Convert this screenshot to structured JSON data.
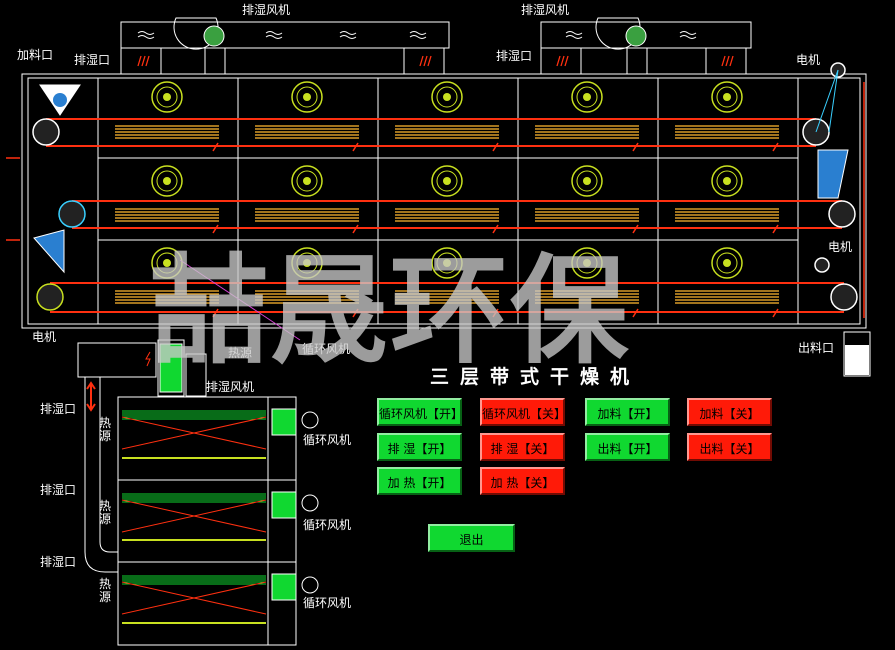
{
  "labels": {
    "dehumid_fan_1": "排湿风机",
    "dehumid_fan_2": "排湿风机",
    "feed_port": "加料口",
    "dehumid_port_1": "排湿口",
    "dehumid_port_2": "排湿口",
    "motor_top": "电机",
    "motor_mid": "电机",
    "motor_bottom": "电机",
    "heat_source": "热源",
    "circ_fan": "循环风机",
    "discharge_port": "出料口",
    "dehumid_fan_side": "排湿风机",
    "side_dehumid_1": "排湿口",
    "side_dehumid_2": "排湿口",
    "side_dehumid_3": "排湿口",
    "side_heat_1": "热源",
    "side_heat_2": "热源",
    "side_heat_3": "热源",
    "side_circ_1": "循环风机",
    "side_circ_2": "循环风机",
    "side_circ_3": "循环风机"
  },
  "title": "三层带式干燥机",
  "watermark": "喆晟环保",
  "buttons": {
    "circ_fan_on": "循环风机【开】",
    "circ_fan_off": "循环风机【关】",
    "dehumid_on": "排  湿【开】",
    "dehumid_off": "排  湿【关】",
    "heat_on": "加  热【开】",
    "heat_off": "加  热【关】",
    "feed_on": "加料【开】",
    "feed_off": "加料【关】",
    "discharge_on": "出料【开】",
    "discharge_off": "出料【关】",
    "exit": "退出"
  },
  "colors": {
    "on": "#10d830",
    "off": "#ff1a08",
    "belt": "#ff3010",
    "heater": "#d89a28",
    "fan": "#c8e020",
    "hopper": "#2a7fd0"
  }
}
